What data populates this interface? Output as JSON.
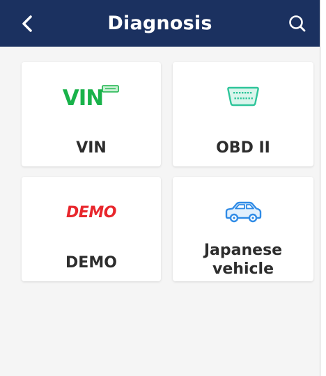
{
  "header": {
    "title": "Diagnosis",
    "background": "#1b3160",
    "back_icon": "chevron-left-icon",
    "search_icon": "search-icon"
  },
  "tiles": [
    {
      "label": "VIN",
      "logo_text": "VIN",
      "icon": "vin-scan-icon",
      "color": "#19b24a"
    },
    {
      "label": "OBD II",
      "icon": "obd-connector-icon",
      "color": "#2ec59a"
    },
    {
      "label": "DEMO",
      "logo_text": "DEMO",
      "icon": "demo-logo",
      "color": "#e8262c"
    },
    {
      "label": "Japanese vehicle",
      "icon": "car-icon",
      "color": "#2f8be6"
    }
  ]
}
